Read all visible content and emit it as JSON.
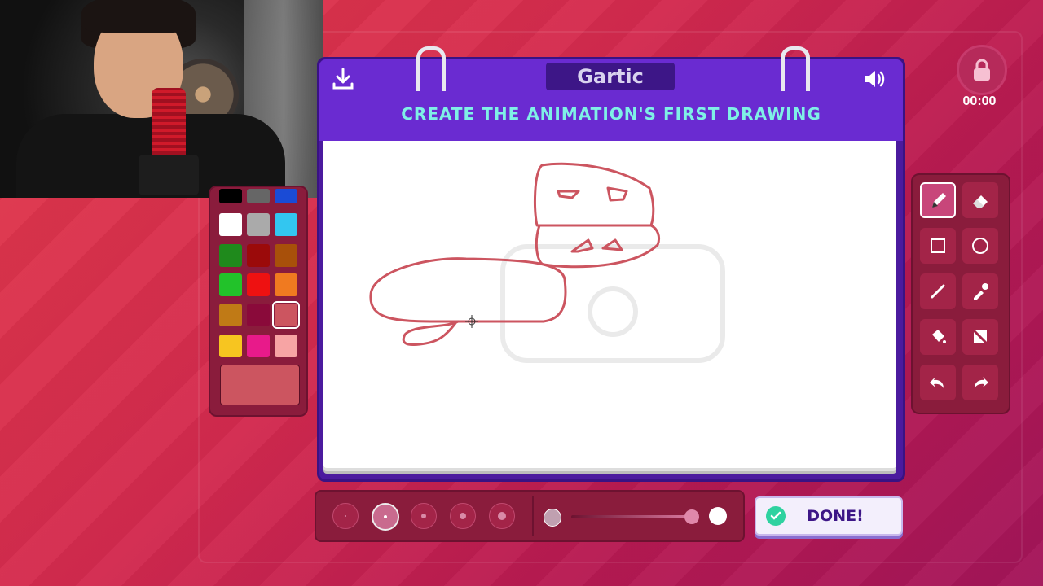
{
  "app": {
    "logo_text": "Gartic",
    "title": "CREATE THE ANIMATION'S FIRST DRAWING",
    "timer": "00:00",
    "done_label": "DONE!"
  },
  "header_icons": {
    "download": "download-icon",
    "sound": "speaker-icon",
    "lock": "lock-icon"
  },
  "palette": {
    "colors": [
      [
        "#000000",
        "#666666",
        "#1a4bd6"
      ],
      [
        "#ffffff",
        "#aaaaaa",
        "#33c6f0"
      ],
      [
        "#1f8a1c",
        "#9b0a0a",
        "#a8500a"
      ],
      [
        "#22c22a",
        "#ee1111",
        "#f07a20"
      ],
      [
        "#c07a16",
        "#8a0a3a",
        "#cc5560"
      ],
      [
        "#f7c520",
        "#e81a8a",
        "#f7a4a4"
      ]
    ],
    "selected_color": "#cc5560",
    "current_color": "#cc5560"
  },
  "tools": [
    {
      "name": "pencil-tool",
      "icon": "pencil-icon",
      "active": true
    },
    {
      "name": "eraser-tool",
      "icon": "eraser-icon",
      "active": false
    },
    {
      "name": "rectangle-tool",
      "icon": "square-icon",
      "active": false
    },
    {
      "name": "ellipse-tool",
      "icon": "circle-icon",
      "active": false
    },
    {
      "name": "line-tool",
      "icon": "line-icon",
      "active": false
    },
    {
      "name": "eyedropper-tool",
      "icon": "eyedropper-icon",
      "active": false
    },
    {
      "name": "fill-tool",
      "icon": "bucket-icon",
      "active": false
    },
    {
      "name": "clear-tool",
      "icon": "clear-icon",
      "active": false
    },
    {
      "name": "undo-button",
      "icon": "undo-icon",
      "active": false
    },
    {
      "name": "redo-button",
      "icon": "redo-icon",
      "active": false
    }
  ],
  "brush_sizes": {
    "count": 5,
    "selected_index": 1
  },
  "opacity_slider": {
    "value": 1.0
  },
  "stroke_color": "#cc5560"
}
